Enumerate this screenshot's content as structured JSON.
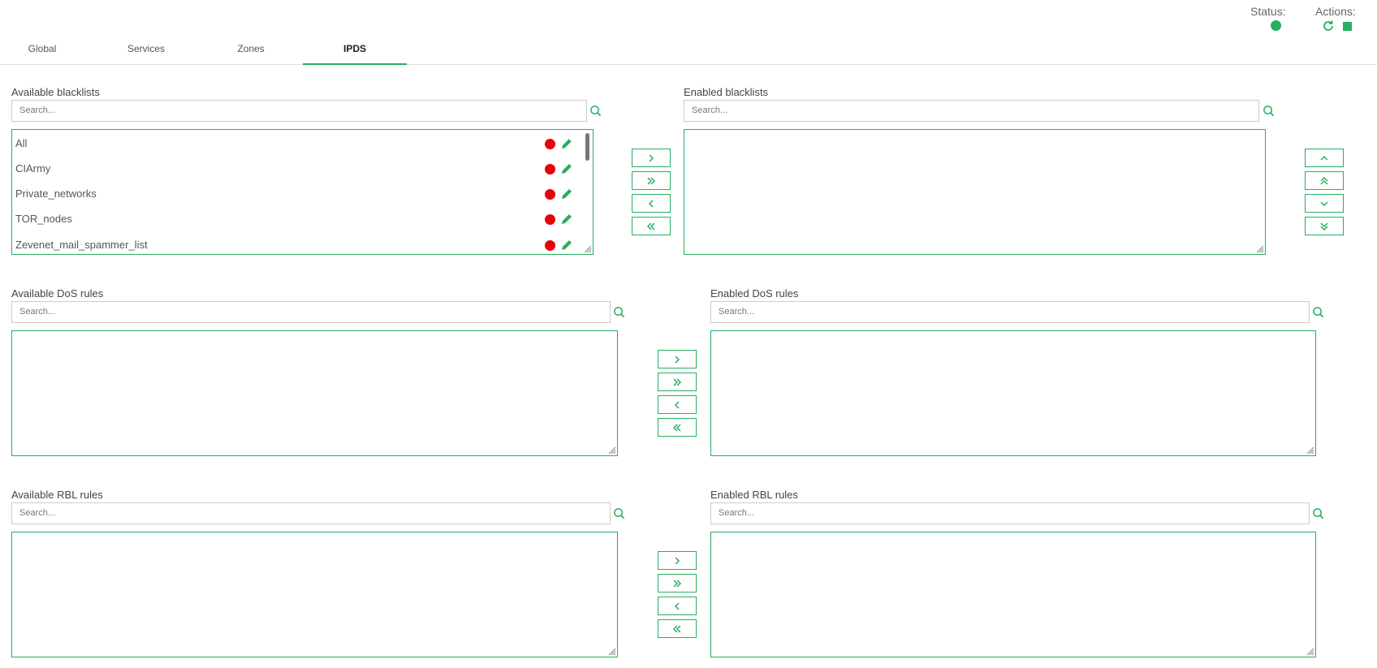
{
  "header": {
    "status_label": "Status:",
    "actions_label": "Actions:",
    "status_color": "#27ae60",
    "actions_icons": [
      "refresh-icon",
      "stop-icon"
    ]
  },
  "tabs": [
    {
      "label": "Global",
      "active": false
    },
    {
      "label": "Services",
      "active": false
    },
    {
      "label": "Zones",
      "active": false
    },
    {
      "label": "IPDS",
      "active": true
    }
  ],
  "blacklists": {
    "available_label": "Available blacklists",
    "enabled_label": "Enabled blacklists",
    "search_placeholder": "Search...",
    "available_items": [
      {
        "name": "All",
        "status_icon": "red-dot-icon",
        "action_icon": "pencil-icon"
      },
      {
        "name": "CIArmy",
        "status_icon": "red-dot-icon",
        "action_icon": "pencil-icon"
      },
      {
        "name": "Private_networks",
        "status_icon": "red-dot-icon",
        "action_icon": "pencil-icon"
      },
      {
        "name": "TOR_nodes",
        "status_icon": "red-dot-icon",
        "action_icon": "pencil-icon"
      },
      {
        "name": "Zevenet_mail_spammer_list",
        "status_icon": "red-dot-icon",
        "action_icon": "pencil-icon"
      }
    ],
    "enabled_items": []
  },
  "dos": {
    "available_label": "Available DoS rules",
    "enabled_label": "Enabled DoS rules",
    "search_placeholder": "Search...",
    "available_items": [],
    "enabled_items": []
  },
  "rbl": {
    "available_label": "Available RBL rules",
    "enabled_label": "Enabled RBL rules",
    "search_placeholder": "Search...",
    "available_items": [],
    "enabled_items": []
  },
  "colors": {
    "accent": "#27ae60",
    "danger": "#e8000b",
    "border": "#cccccc"
  }
}
